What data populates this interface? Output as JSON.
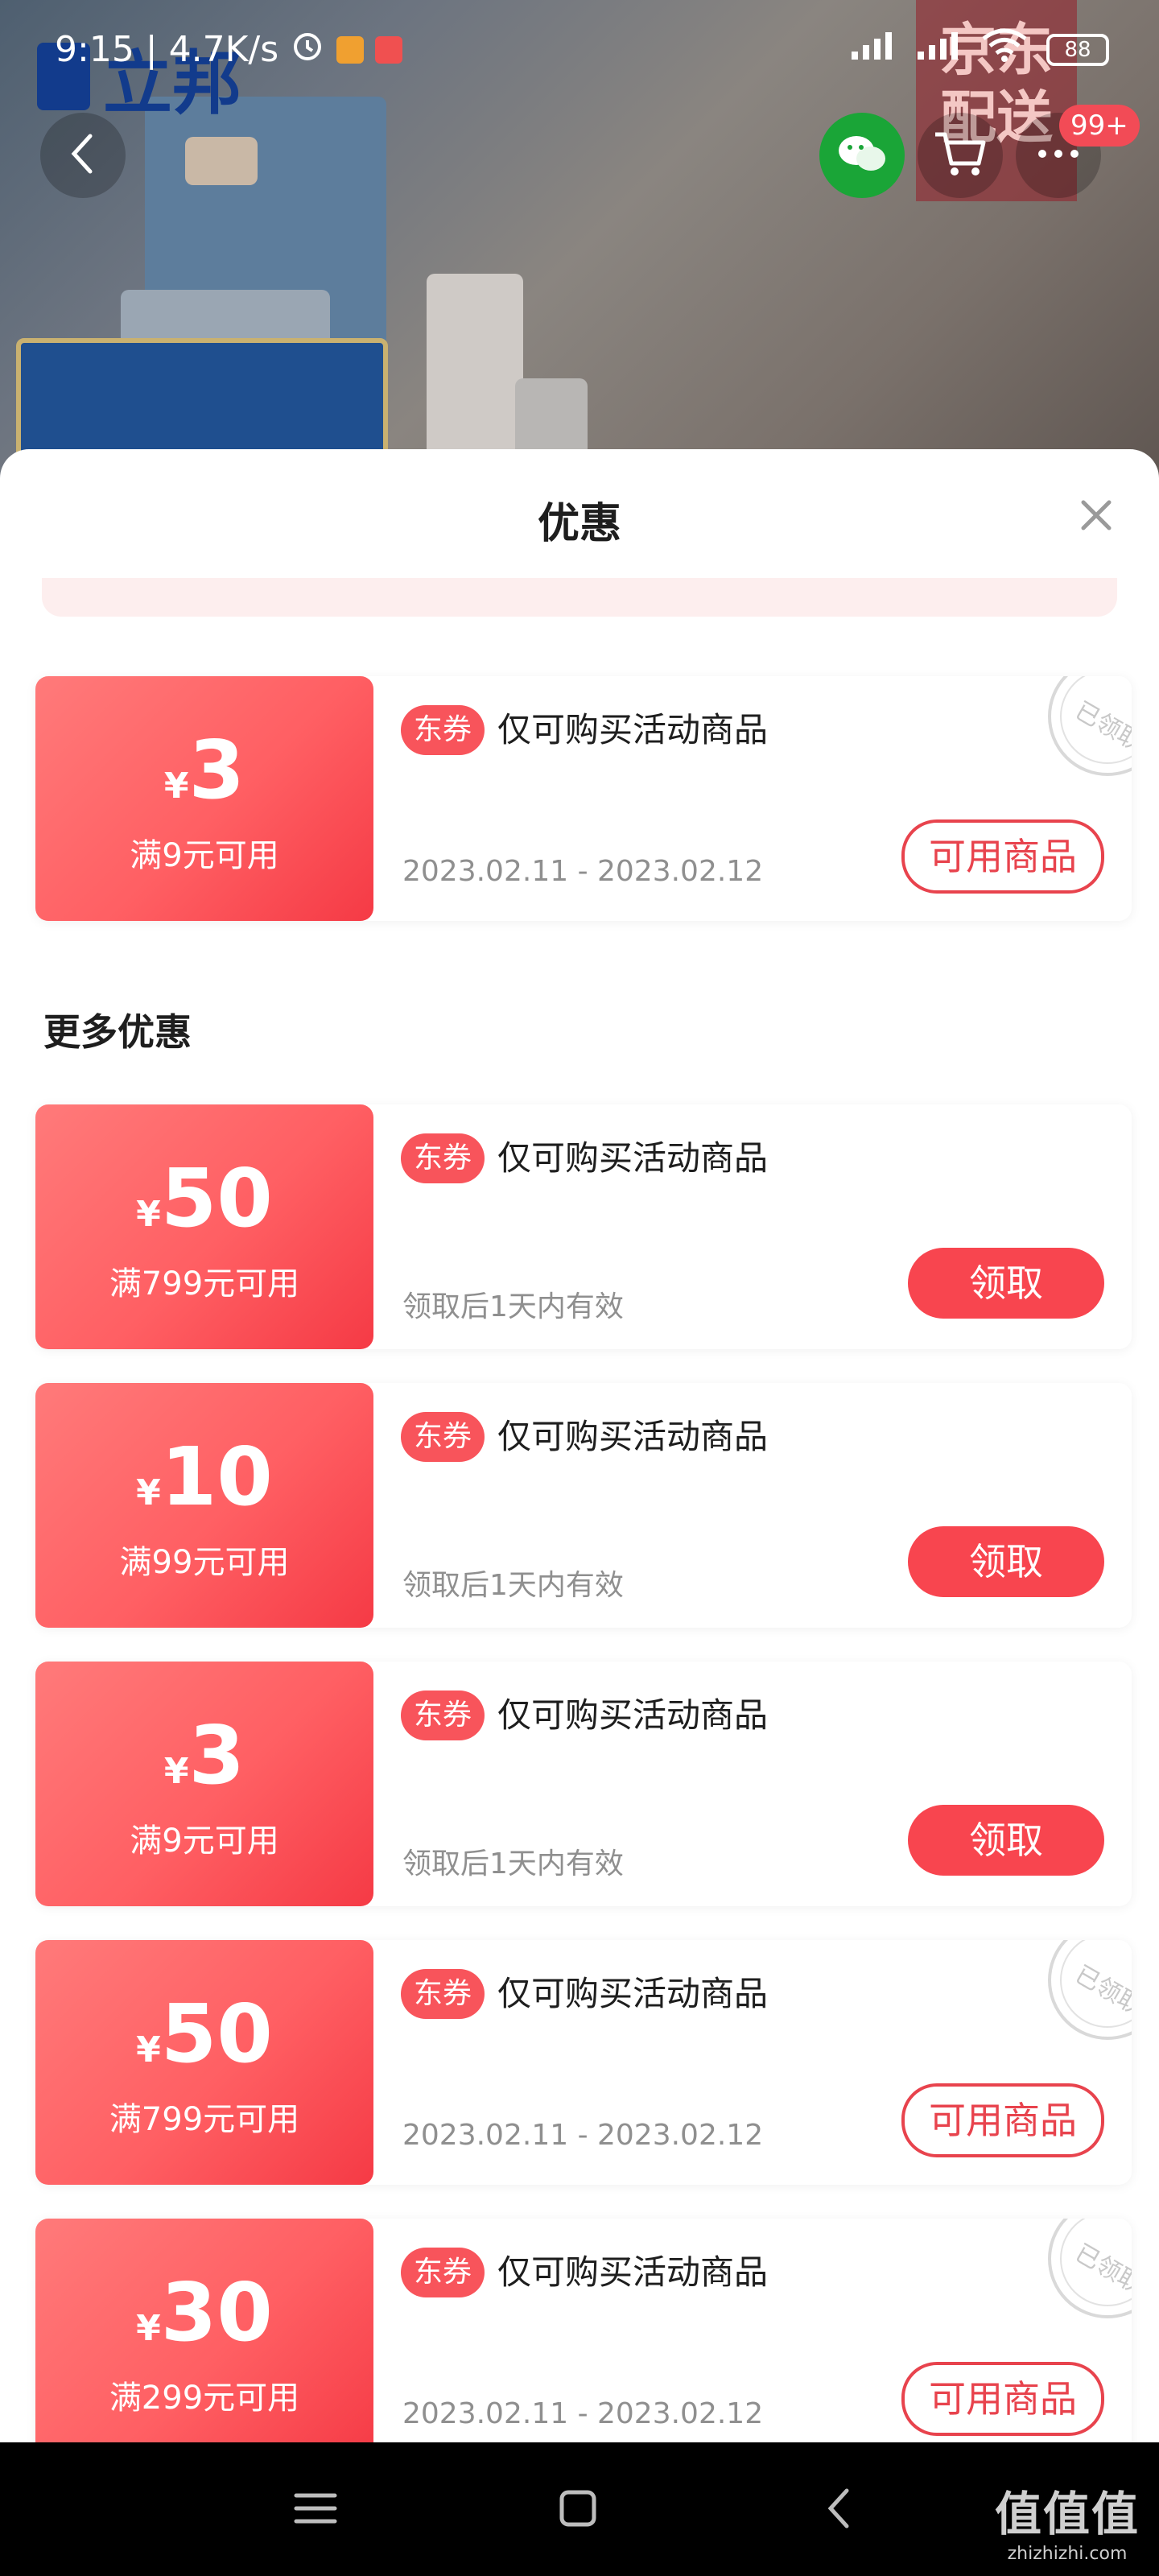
{
  "status_bar": {
    "time_speed": "9:15 | 4.7K/s",
    "battery": "88"
  },
  "colors": {
    "accent": "#f8454f",
    "coupon_gradient_start": "#ff7a7a",
    "coupon_gradient_end": "#f53a45",
    "tag_bg": "#f8545b"
  },
  "background": {
    "brand_text": "立邦",
    "promo_badge_text": "京东配送",
    "cart_count": "99+"
  },
  "sheet": {
    "title": "优惠",
    "section_more": "更多优惠"
  },
  "coupons": [
    {
      "yen": "¥",
      "amount": "3",
      "condition": "满9元可用",
      "tag": "东券",
      "description": "仅可购买活动商品",
      "validity": "2023.02.11 - 2023.02.12",
      "action": "可用商品",
      "claimed": true
    },
    {
      "yen": "¥",
      "amount": "50",
      "condition": "满799元可用",
      "tag": "东券",
      "description": "仅可购买活动商品",
      "validity": "领取后1天内有效",
      "action": "领取",
      "claimed": false
    },
    {
      "yen": "¥",
      "amount": "10",
      "condition": "满99元可用",
      "tag": "东券",
      "description": "仅可购买活动商品",
      "validity": "领取后1天内有效",
      "action": "领取",
      "claimed": false
    },
    {
      "yen": "¥",
      "amount": "3",
      "condition": "满9元可用",
      "tag": "东券",
      "description": "仅可购买活动商品",
      "validity": "领取后1天内有效",
      "action": "领取",
      "claimed": false
    },
    {
      "yen": "¥",
      "amount": "50",
      "condition": "满799元可用",
      "tag": "东券",
      "description": "仅可购买活动商品",
      "validity": "2023.02.11 - 2023.02.12",
      "action": "可用商品",
      "claimed": true
    },
    {
      "yen": "¥",
      "amount": "30",
      "condition": "满299元可用",
      "tag": "东券",
      "description": "仅可购买活动商品",
      "validity": "2023.02.11 - 2023.02.12",
      "action": "可用商品",
      "claimed": true
    }
  ],
  "stamp_text": "已领取",
  "watermark": {
    "main": "值值值",
    "sub": "zhizhizhi.com"
  }
}
